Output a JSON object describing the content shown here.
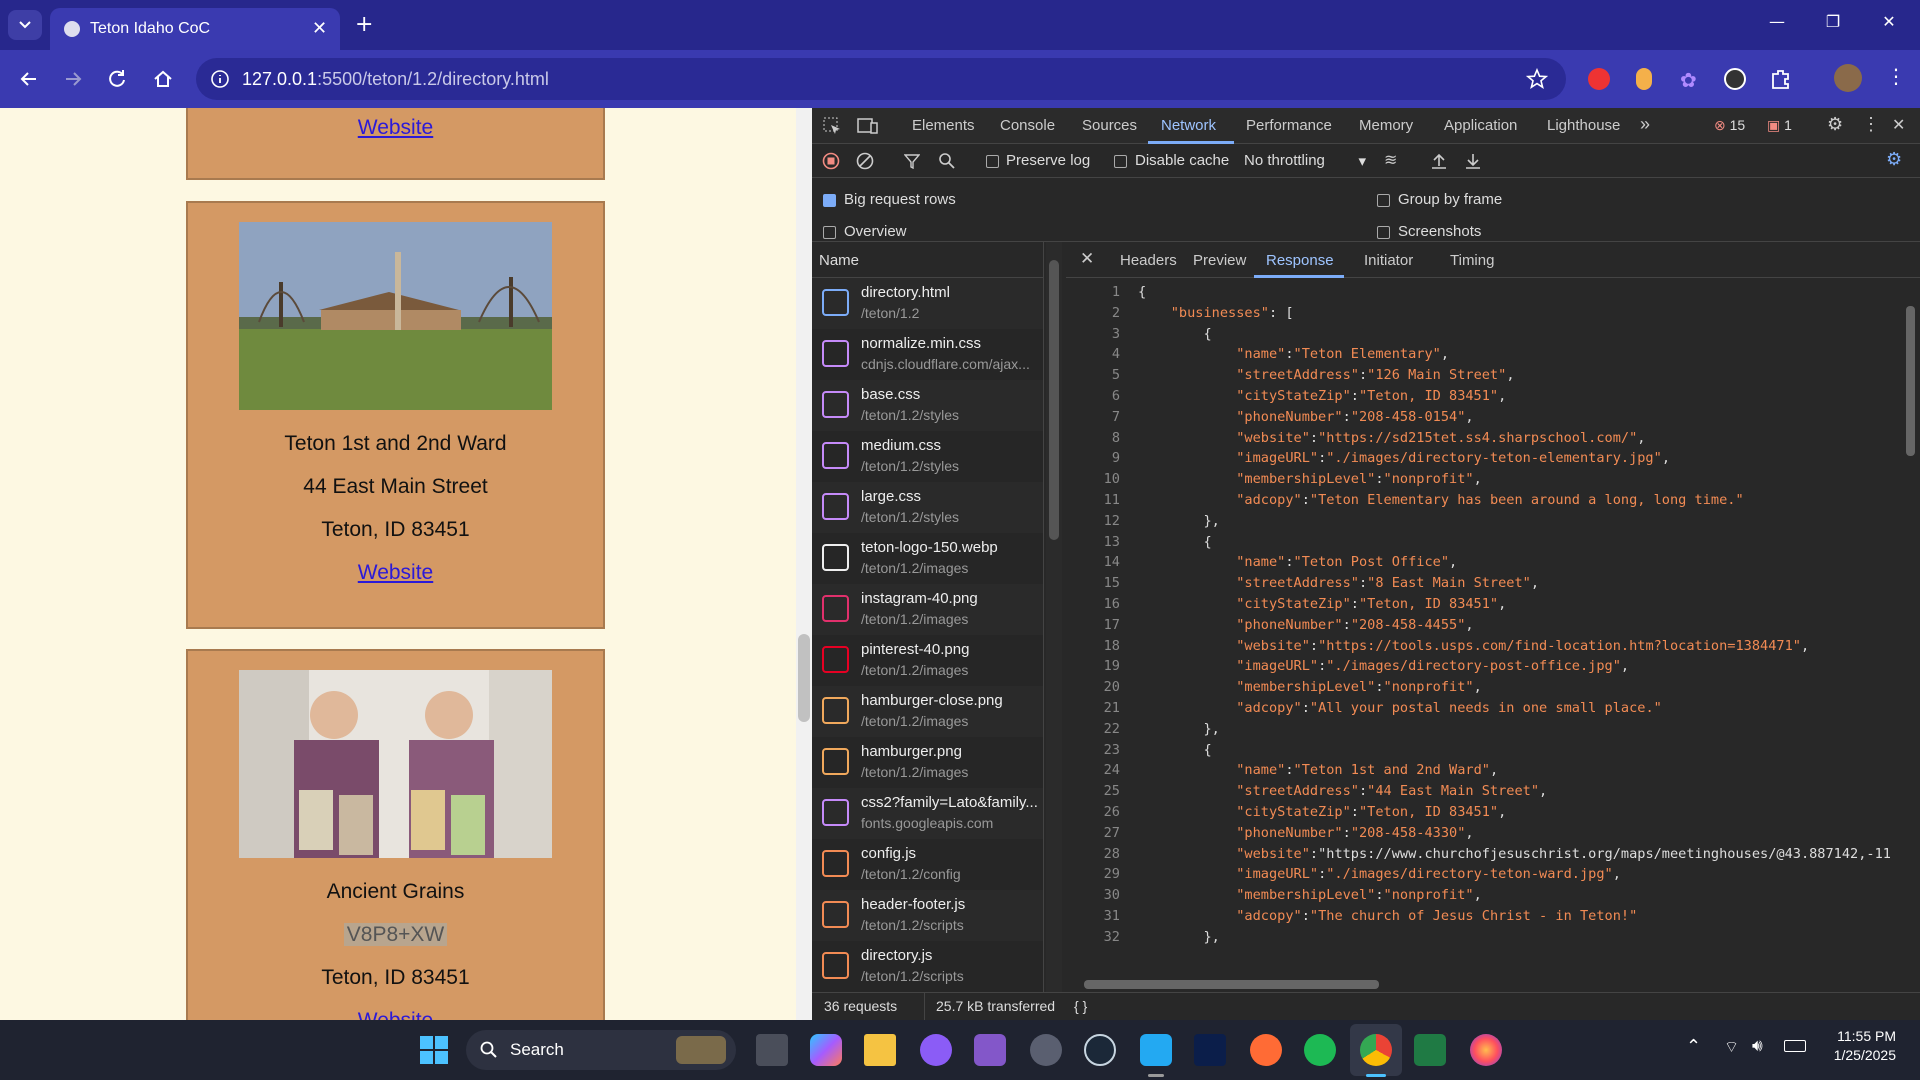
{
  "browser": {
    "tab_title": "Teton Idaho CoC",
    "url_host": "127.0.0.1",
    "url_path": ":5500/teton/1.2/directory.html"
  },
  "page": {
    "top_card": {
      "link": "Website"
    },
    "cards": [
      {
        "name": "Teton 1st and 2nd Ward",
        "address": "44 East Main Street",
        "city": "Teton, ID 83451",
        "link": "Website"
      },
      {
        "name": "Ancient Grains",
        "address": "V8P8+XW",
        "city": "Teton, ID 83451",
        "link": "Website"
      }
    ]
  },
  "devtools": {
    "tabs": [
      "Elements",
      "Console",
      "Sources",
      "Network",
      "Performance",
      "Memory",
      "Application",
      "Lighthouse"
    ],
    "active_tab": "Network",
    "error_count": "15",
    "issue_count": "1",
    "toolbar": {
      "preserve_log": "Preserve log",
      "disable_cache": "Disable cache",
      "throttling": "No throttling"
    },
    "settings": {
      "big_rows": "Big request rows",
      "overview": "Overview",
      "group_by_frame": "Group by frame",
      "screenshots": "Screenshots"
    },
    "list_header": "Name",
    "requests": [
      {
        "name": "directory.html",
        "path": "/teton/1.2",
        "icon": "document-icon",
        "color": "#7cacf8"
      },
      {
        "name": "normalize.min.css",
        "path": "cdnjs.cloudflare.com/ajax...",
        "icon": "stylesheet-icon",
        "color": "#c58af9"
      },
      {
        "name": "base.css",
        "path": "/teton/1.2/styles",
        "icon": "stylesheet-icon",
        "color": "#c58af9"
      },
      {
        "name": "medium.css",
        "path": "/teton/1.2/styles",
        "icon": "stylesheet-icon",
        "color": "#c58af9"
      },
      {
        "name": "large.css",
        "path": "/teton/1.2/styles",
        "icon": "stylesheet-icon",
        "color": "#c58af9"
      },
      {
        "name": "teton-logo-150.webp",
        "path": "/teton/1.2/images",
        "icon": "image-icon",
        "color": "#eeeeee"
      },
      {
        "name": "instagram-40.png",
        "path": "/teton/1.2/images",
        "icon": "instagram-icon",
        "color": "#e1306c"
      },
      {
        "name": "pinterest-40.png",
        "path": "/teton/1.2/images",
        "icon": "pinterest-icon",
        "color": "#e60023"
      },
      {
        "name": "hamburger-close.png",
        "path": "/teton/1.2/images",
        "icon": "close-image-icon",
        "color": "#f0a85c"
      },
      {
        "name": "hamburger.png",
        "path": "/teton/1.2/images",
        "icon": "menu-image-icon",
        "color": "#f0a85c"
      },
      {
        "name": "css2?family=Lato&family...",
        "path": "fonts.googleapis.com",
        "icon": "stylesheet-icon",
        "color": "#c58af9"
      },
      {
        "name": "config.js",
        "path": "/teton/1.2/config",
        "icon": "script-icon",
        "color": "#f28b54"
      },
      {
        "name": "header-footer.js",
        "path": "/teton/1.2/scripts",
        "icon": "script-icon",
        "color": "#f28b54"
      },
      {
        "name": "directory.js",
        "path": "/teton/1.2/scripts",
        "icon": "script-icon",
        "color": "#f28b54"
      }
    ],
    "detail_tabs": [
      "Headers",
      "Preview",
      "Response",
      "Initiator",
      "Timing"
    ],
    "active_detail_tab": "Response",
    "response_lines": [
      "{",
      "    \"businesses\": [",
      "        {",
      "            \"name\":\"Teton Elementary\",",
      "            \"streetAddress\":\"126 Main Street\",",
      "            \"cityStateZip\":\"Teton, ID 83451\",",
      "            \"phoneNumber\":\"208-458-0154\",",
      "            \"website\":\"https://sd215tet.ss4.sharpschool.com/\",",
      "            \"imageURL\":\"./images/directory-teton-elementary.jpg\",",
      "            \"membershipLevel\":\"nonprofit\",",
      "            \"adcopy\":\"Teton Elementary has been around a long, long time.\"",
      "        },",
      "        {",
      "            \"name\":\"Teton Post Office\",",
      "            \"streetAddress\":\"8 East Main Street\",",
      "            \"cityStateZip\":\"Teton, ID 83451\",",
      "            \"phoneNumber\":\"208-458-4455\",",
      "            \"website\":\"https://tools.usps.com/find-location.htm?location=1384471\",",
      "            \"imageURL\":\"./images/directory-post-office.jpg\",",
      "            \"membershipLevel\":\"nonprofit\",",
      "            \"adcopy\":\"All your postal needs in one small place.\"",
      "        },",
      "        {",
      "            \"name\":\"Teton 1st and 2nd Ward\",",
      "            \"streetAddress\":\"44 East Main Street\",",
      "            \"cityStateZip\":\"Teton, ID 83451\",",
      "            \"phoneNumber\":\"208-458-4330\",",
      "            \"website\":\"https://www.churchofjesuschrist.org/maps/meetinghouses/@43.887142,-11",
      "            \"imageURL\":\"./images/directory-teton-ward.jpg\",",
      "            \"membershipLevel\":\"nonprofit\",",
      "            \"adcopy\":\"The church of Jesus Christ - in Teton!\"",
      "        },"
    ],
    "status": {
      "requests": "36 requests",
      "transferred": "25.7 kB transferred",
      "format": "{ }"
    }
  },
  "taskbar": {
    "search_label": "Search",
    "time": "11:55 PM",
    "date": "1/25/2025"
  }
}
